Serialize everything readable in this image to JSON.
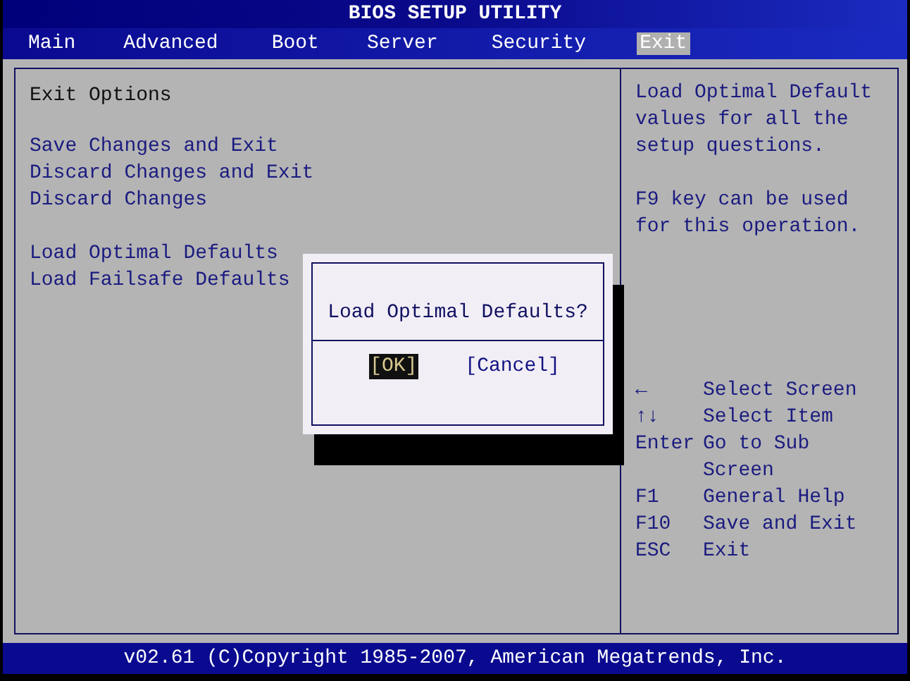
{
  "title": "BIOS SETUP UTILITY",
  "tabs": [
    {
      "label": "Main",
      "selected": false
    },
    {
      "label": "Advanced",
      "selected": false
    },
    {
      "label": "Boot",
      "selected": false
    },
    {
      "label": "Server",
      "selected": false
    },
    {
      "label": "Security",
      "selected": false
    },
    {
      "label": "Exit",
      "selected": true
    }
  ],
  "section_title": "Exit Options",
  "menu_groups": [
    [
      "Save Changes and Exit",
      "Discard Changes and Exit",
      "Discard Changes"
    ],
    [
      "Load Optimal Defaults",
      "Load Failsafe Defaults"
    ]
  ],
  "help_text": [
    "Load Optimal Default values for all the setup questions.",
    "F9 key can be used for this operation."
  ],
  "key_help": [
    {
      "key": "←",
      "action": "Select Screen"
    },
    {
      "key": "↑↓",
      "action": "Select Item"
    },
    {
      "key": "Enter",
      "action": "Go to Sub Screen"
    },
    {
      "key": "F1",
      "action": "General Help"
    },
    {
      "key": "F10",
      "action": "Save and Exit"
    },
    {
      "key": "ESC",
      "action": "Exit"
    }
  ],
  "dialog": {
    "question": "Load Optimal Defaults?",
    "buttons": [
      {
        "label": "[OK]",
        "selected": true
      },
      {
        "label": "[Cancel]",
        "selected": false
      }
    ]
  },
  "footer": "v02.61 (C)Copyright 1985-2007, American Megatrends, Inc."
}
